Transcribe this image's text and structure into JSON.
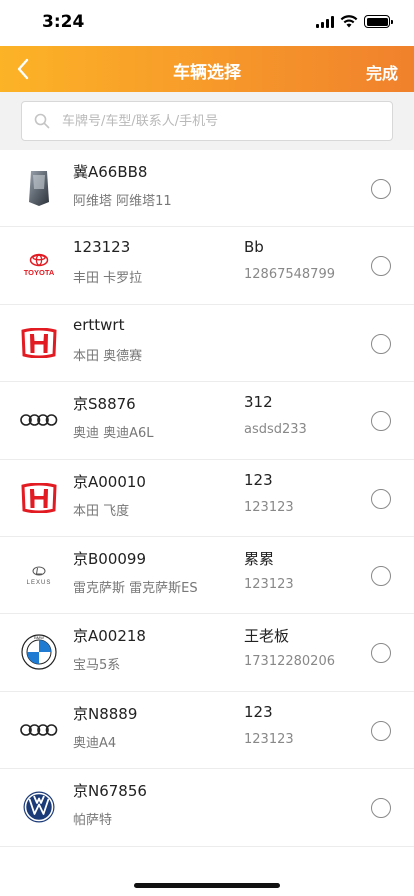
{
  "status": {
    "time": "3:24"
  },
  "nav": {
    "title": "车辆选择",
    "done_label": "完成"
  },
  "search": {
    "placeholder": "车牌号/车型/联系人/手机号",
    "value": ""
  },
  "colors": {
    "accent_start": "#fcb326",
    "accent_end": "#f0812c"
  },
  "vehicles": [
    {
      "plate": "冀A66BB8",
      "model": "阿维塔 阿维塔11",
      "contact": "",
      "phone": "",
      "logo": "avatr-car-image",
      "selected": false
    },
    {
      "plate": "123123",
      "model": "丰田 卡罗拉",
      "contact": "Bb",
      "phone": "12867548799",
      "logo": "toyota-logo",
      "logo_text": "TOYOTA",
      "selected": false
    },
    {
      "plate": "erttwrt",
      "model": "本田 奥德赛",
      "contact": "",
      "phone": "",
      "logo": "honda-logo",
      "selected": false
    },
    {
      "plate": "京S8876",
      "model": "奥迪 奥迪A6L",
      "contact": "312",
      "phone": "asdsd233",
      "logo": "audi-logo",
      "selected": false
    },
    {
      "plate": "京A00010",
      "model": "本田 飞度",
      "contact": "123",
      "phone": "123123",
      "logo": "honda-logo",
      "selected": false
    },
    {
      "plate": "京B00099",
      "model": "雷克萨斯 雷克萨斯ES",
      "contact": "累累",
      "phone": "123123",
      "logo": "lexus-logo",
      "logo_text": "LEXUS",
      "selected": false
    },
    {
      "plate": "京A00218",
      "model": "宝马5系",
      "contact": "王老板",
      "phone": "17312280206",
      "logo": "bmw-logo",
      "logo_text": "BMW",
      "selected": false
    },
    {
      "plate": "京N8889",
      "model": "奥迪A4",
      "contact": "123",
      "phone": "123123",
      "logo": "audi-logo",
      "selected": false
    },
    {
      "plate": "京N67856",
      "model": "帕萨特",
      "contact": "",
      "phone": "",
      "logo": "volkswagen-logo",
      "selected": false
    }
  ]
}
